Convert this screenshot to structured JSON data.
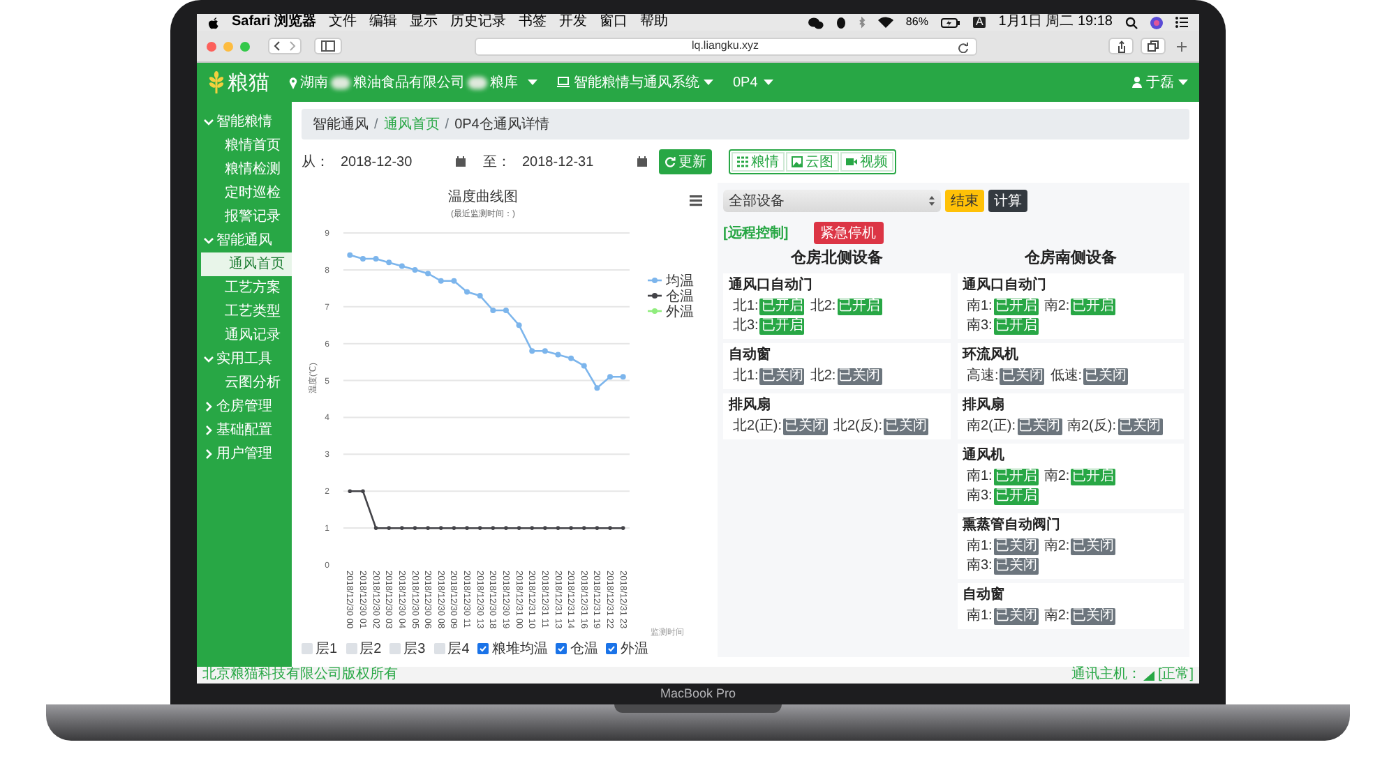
{
  "menu_bar": {
    "app": "Safari 浏览器",
    "menus": [
      "文件",
      "编辑",
      "显示",
      "历史记录",
      "书签",
      "开发",
      "窗口",
      "帮助"
    ],
    "battery": "86%",
    "input_source": "A",
    "clock": "1月1日 周二 19:18"
  },
  "browser": {
    "url": "lq.liangku.xyz"
  },
  "navbar": {
    "brand": "粮猫",
    "location_parts": [
      "湖南",
      "粮油食品有限公司",
      "粮库"
    ],
    "system": "智能粮情与通风系统",
    "warehouse": "0P4",
    "user": "于磊"
  },
  "sidebar": {
    "items": [
      {
        "label": "智能粮情",
        "expanded": true,
        "selected": false,
        "children": [
          {
            "label": "粮情首页",
            "selected": false
          },
          {
            "label": "粮情检测",
            "selected": false
          },
          {
            "label": "定时巡检",
            "selected": false
          },
          {
            "label": "报警记录",
            "selected": false
          }
        ]
      },
      {
        "label": "智能通风",
        "expanded": true,
        "selected": false,
        "children": [
          {
            "label": "通风首页",
            "selected": true
          },
          {
            "label": "工艺方案",
            "selected": false
          },
          {
            "label": "工艺类型",
            "selected": false
          },
          {
            "label": "通风记录",
            "selected": false
          }
        ]
      },
      {
        "label": "实用工具",
        "expanded": true,
        "selected": false,
        "children": [
          {
            "label": "云图分析",
            "selected": false
          }
        ]
      },
      {
        "label": "仓房管理",
        "expanded": false,
        "selected": false
      },
      {
        "label": "基础配置",
        "expanded": false,
        "selected": false
      },
      {
        "label": "用户管理",
        "expanded": false,
        "selected": false
      }
    ]
  },
  "breadcrumb": {
    "separator": "/",
    "items": [
      {
        "label": "智能通风",
        "link": false
      },
      {
        "label": "通风首页",
        "link": true
      },
      {
        "label": "0P4仓通风详情",
        "link": false
      }
    ]
  },
  "date_filter": {
    "from_label": "从：",
    "from": "2018-12-30",
    "to_label": "至：",
    "to": "2018-12-31",
    "refresh_button": "更新"
  },
  "view_tabs": [
    {
      "label": "粮情",
      "kind": "grid"
    },
    {
      "label": "云图",
      "kind": "image"
    },
    {
      "label": "视频",
      "kind": "video"
    }
  ],
  "chart": {
    "subtitle": "(最近监测时间：)",
    "legend_toggles": [
      {
        "label": "层1",
        "checked": false
      },
      {
        "label": "层2",
        "checked": false
      },
      {
        "label": "层3",
        "checked": false
      },
      {
        "label": "层4",
        "checked": false
      },
      {
        "label": "粮堆均温",
        "checked": true
      },
      {
        "label": "仓温",
        "checked": true
      },
      {
        "label": "外温",
        "checked": true
      }
    ],
    "chart_data": {
      "type": "line",
      "title": "温度曲线图",
      "xlabel": "监测时间",
      "ylabel": "温度(℃)",
      "categories": [
        "2018/12/30 00",
        "2018/12/30 01",
        "2018/12/30 02",
        "2018/12/30 03",
        "2018/12/30 04",
        "2018/12/30 05",
        "2018/12/30 06",
        "2018/12/30 08",
        "2018/12/30 09",
        "2018/12/30 11",
        "2018/12/30 13",
        "2018/12/30 18",
        "2018/12/30 19",
        "2018/12/31 00",
        "2018/12/31 10",
        "2018/12/31 11",
        "2018/12/31 13",
        "2018/12/31 14",
        "2018/12/31 16",
        "2018/12/31 19",
        "2018/12/31 22",
        "2018/12/31 23"
      ],
      "ylim": [
        0,
        9
      ],
      "grid": true,
      "legend": true,
      "yticks": [
        0,
        1,
        2,
        3,
        4,
        5,
        6,
        7,
        8,
        9
      ],
      "series": [
        {
          "name": "均温",
          "color": "#7cb5ec",
          "marker": true,
          "values": [
            8.4,
            8.3,
            8.3,
            8.2,
            8.1,
            8.0,
            7.9,
            7.7,
            7.7,
            7.4,
            7.3,
            6.9,
            6.9,
            6.5,
            5.8,
            5.8,
            5.7,
            5.6,
            5.4,
            4.8,
            5.1,
            5.1
          ]
        },
        {
          "name": "仓温",
          "color": "#434348",
          "marker": true,
          "values": [
            2,
            2,
            1,
            1,
            1,
            1,
            1,
            1,
            1,
            1,
            1,
            1,
            1,
            1,
            1,
            1,
            1,
            1,
            1,
            1,
            1,
            1
          ]
        },
        {
          "name": "外温",
          "color": "#90ed7d",
          "marker": true,
          "values": [
            null,
            null,
            null,
            null,
            null,
            null,
            null,
            null,
            null,
            null,
            null,
            null,
            null,
            null,
            null,
            null,
            null,
            null,
            null,
            null,
            null,
            null
          ]
        }
      ]
    }
  },
  "control_panel": {
    "device_select": "全部设备",
    "end_button": "结束",
    "calc_button": "计算",
    "remote_label": "[远程控制]",
    "stop_button": "紧急停机",
    "columns": [
      {
        "title": "仓房北侧设备",
        "groups": [
          {
            "title": "通风口自动门",
            "items": [
              {
                "label": "北1:",
                "on": true,
                "status": "已开启"
              },
              {
                "label": "北2:",
                "on": true,
                "status": "已开启"
              },
              {
                "label": "北3:",
                "on": true,
                "status": "已开启"
              }
            ]
          },
          {
            "title": "自动窗",
            "items": [
              {
                "label": "北1:",
                "on": false,
                "status": "已关闭"
              },
              {
                "label": "北2:",
                "on": false,
                "status": "已关闭"
              }
            ]
          },
          {
            "title": "排风扇",
            "items": [
              {
                "label": "北2(正):",
                "on": false,
                "status": "已关闭"
              },
              {
                "label": "北2(反):",
                "on": false,
                "status": "已关闭"
              }
            ]
          }
        ]
      },
      {
        "title": "仓房南侧设备",
        "groups": [
          {
            "title": "通风口自动门",
            "items": [
              {
                "label": "南1:",
                "on": true,
                "status": "已开启"
              },
              {
                "label": "南2:",
                "on": true,
                "status": "已开启"
              },
              {
                "label": "南3:",
                "on": true,
                "status": "已开启"
              }
            ]
          },
          {
            "title": "环流风机",
            "items": [
              {
                "label": "高速:",
                "on": false,
                "status": "已关闭"
              },
              {
                "label": "低速:",
                "on": false,
                "status": "已关闭"
              }
            ]
          },
          {
            "title": "排风扇",
            "items": [
              {
                "label": "南2(正):",
                "on": false,
                "status": "已关闭"
              },
              {
                "label": "南2(反):",
                "on": false,
                "status": "已关闭"
              }
            ]
          },
          {
            "title": "通风机",
            "items": [
              {
                "label": "南1:",
                "on": true,
                "status": "已开启"
              },
              {
                "label": "南2:",
                "on": true,
                "status": "已开启"
              },
              {
                "label": "南3:",
                "on": true,
                "status": "已开启"
              }
            ]
          },
          {
            "title": "熏蒸管自动阀门",
            "items": [
              {
                "label": "南1:",
                "on": false,
                "status": "已关闭"
              },
              {
                "label": "南2:",
                "on": false,
                "status": "已关闭"
              },
              {
                "label": "南3:",
                "on": false,
                "status": "已关闭"
              }
            ]
          },
          {
            "title": "自动窗",
            "items": [
              {
                "label": "南1:",
                "on": false,
                "status": "已关闭"
              },
              {
                "label": "南2:",
                "on": false,
                "status": "已关闭"
              }
            ]
          }
        ]
      }
    ]
  },
  "footer": {
    "copyright": "北京粮猫科技有限公司版权所有",
    "host_label": "通讯主机：",
    "host_status": "[正常]"
  },
  "device_label": "MacBook Pro"
}
